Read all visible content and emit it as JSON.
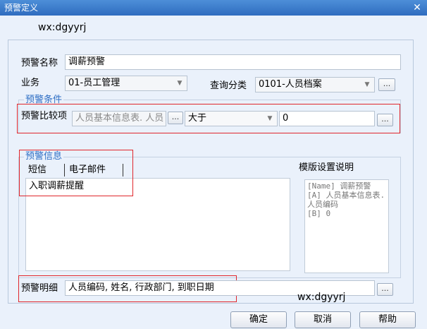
{
  "window": {
    "title": "预警定义",
    "close_glyph": "✕"
  },
  "watermark": {
    "top": "wx:dgyyrj",
    "bottom": "wx:dgyyrj"
  },
  "form": {
    "name_label": "预警名称",
    "name_value": "调薪预警",
    "business_label": "业务",
    "business_value": "01-员工管理",
    "query_label": "查询分类",
    "query_value": "0101-人员档案",
    "browse_label": "..."
  },
  "condition": {
    "group_title": "预警条件",
    "compare_label": "预警比较项",
    "compare_value": "人员基本信息表. 人员",
    "operator_value": "大于",
    "threshold_value": "0"
  },
  "info": {
    "group_title": "预警信息",
    "tabs": [
      "短信",
      "电子邮件"
    ],
    "content": "入职调薪提醒",
    "template_title": "模版设置说明",
    "template_preview": "[Name] 调薪预警\n[A] 人员基本信息表. 人员编码\n[B] 0"
  },
  "detail": {
    "label": "预警明细",
    "value": "人员编码, 姓名, 行政部门, 到职日期"
  },
  "buttons": {
    "ok": "确定",
    "cancel": "取消",
    "help": "帮助"
  },
  "icons": {
    "dropdown": "▼"
  }
}
